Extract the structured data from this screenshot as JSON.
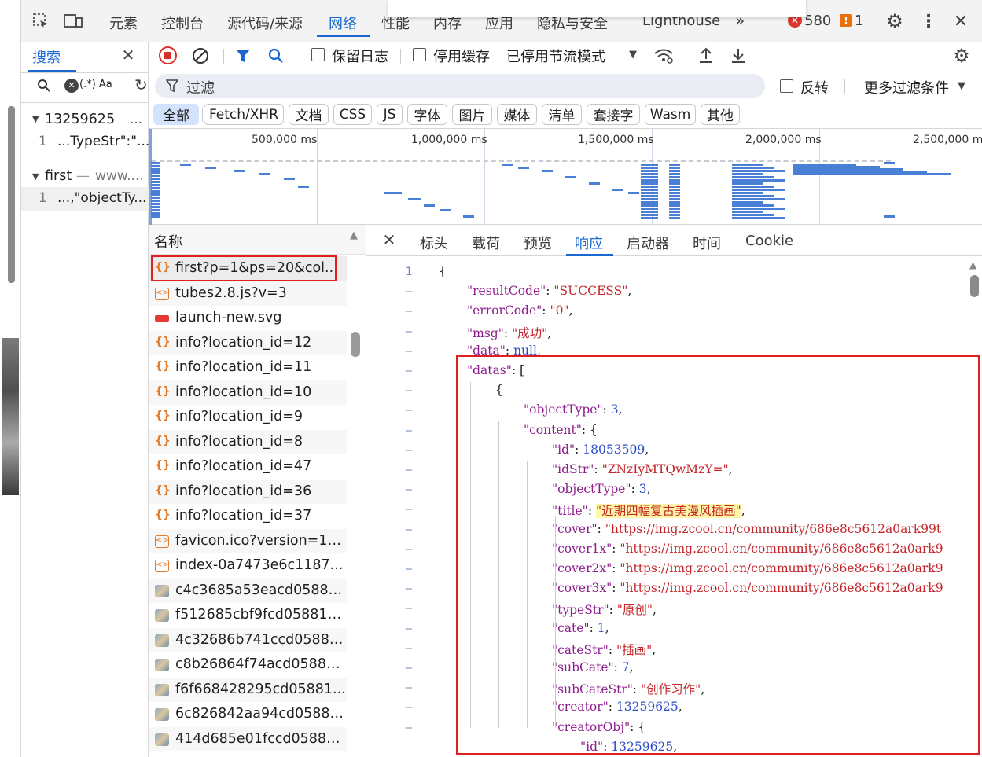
{
  "topbar": {
    "tabs": [
      "元素",
      "控制台",
      "源代码/来源",
      "网络",
      "性能",
      "内存",
      "应用",
      "隐私与安全",
      "Lighthouse"
    ],
    "active_tab": "网络",
    "more": "»",
    "error_count": "580",
    "warning_count": "1"
  },
  "search_panel": {
    "title": "搜索",
    "options_text": "(.*) Aa",
    "results": [
      {
        "file": "13259625",
        "trail": "...",
        "line": "1",
        "snippet": "...TypeStr\":\"..."
      },
      {
        "file": "first",
        "trail": "www....",
        "line": "1",
        "snippet": "...,\"objectTy..."
      }
    ]
  },
  "network_toolbar": {
    "preserve_log": "保留日志",
    "disable_cache": "停用缓存",
    "throttling": "已停用节流模式"
  },
  "filter": {
    "placeholder": "过滤",
    "invert": "反转",
    "more_filters": "更多过滤条件"
  },
  "type_filters": [
    "全部",
    "Fetch/XHR",
    "文档",
    "CSS",
    "JS",
    "字体",
    "图片",
    "媒体",
    "清单",
    "套接字",
    "Wasm",
    "其他"
  ],
  "overview": {
    "ticks": [
      "500,000 ms",
      "1,000,000 ms",
      "1,500,000 ms",
      "2,000,000 ms",
      "2,500,000 ms"
    ]
  },
  "requests": {
    "header": "名称",
    "rows": [
      {
        "name": "first?p=1&ps=20&col...",
        "type": "xhr"
      },
      {
        "name": "tubes2.8.js?v=3",
        "type": "script"
      },
      {
        "name": "launch-new.svg",
        "type": "svg"
      },
      {
        "name": "info?location_id=12",
        "type": "xhr"
      },
      {
        "name": "info?location_id=11",
        "type": "xhr"
      },
      {
        "name": "info?location_id=10",
        "type": "xhr"
      },
      {
        "name": "info?location_id=9",
        "type": "xhr"
      },
      {
        "name": "info?location_id=8",
        "type": "xhr"
      },
      {
        "name": "info?location_id=47",
        "type": "xhr"
      },
      {
        "name": "info?location_id=36",
        "type": "xhr"
      },
      {
        "name": "info?location_id=37",
        "type": "xhr"
      },
      {
        "name": "favicon.ico?version=16...",
        "type": "script"
      },
      {
        "name": "index-0a7473e6c1187...",
        "type": "script"
      },
      {
        "name": "c4c3685a53eacd05881...",
        "type": "img"
      },
      {
        "name": "f512685cbf9fcd058810...",
        "type": "img"
      },
      {
        "name": "4c32686b741ccd05881...",
        "type": "img"
      },
      {
        "name": "c8b26864f74acd05881...",
        "type": "img"
      },
      {
        "name": "f6f668428295cd05881...",
        "type": "img"
      },
      {
        "name": "6c826842aa94cd05881...",
        "type": "img"
      },
      {
        "name": "414d685e01fccd05881...",
        "type": "img"
      }
    ]
  },
  "detail_tabs": [
    "标头",
    "载荷",
    "预览",
    "响应",
    "启动器",
    "时间",
    "Cookie"
  ],
  "detail_active": "响应",
  "response": {
    "line_numbers": [
      "1",
      "–",
      "–",
      "–",
      "–",
      "–",
      "–",
      "–",
      "–",
      "–",
      "–",
      "–",
      "–",
      "–",
      "–",
      "–",
      "–",
      "–",
      "–",
      "–",
      "–",
      "–",
      "–",
      "–"
    ],
    "lines": [
      {
        "indent": 0,
        "parts": [
          [
            "p",
            "{"
          ]
        ]
      },
      {
        "indent": 1,
        "parts": [
          [
            "k",
            "\"resultCode\""
          ],
          [
            "p",
            ": "
          ],
          [
            "s",
            "\"SUCCESS\""
          ],
          [
            "p",
            ","
          ]
        ]
      },
      {
        "indent": 1,
        "parts": [
          [
            "k",
            "\"errorCode\""
          ],
          [
            "p",
            ": "
          ],
          [
            "s",
            "\"0\""
          ],
          [
            "p",
            ","
          ]
        ]
      },
      {
        "indent": 1,
        "parts": [
          [
            "k",
            "\"msg\""
          ],
          [
            "p",
            ": "
          ],
          [
            "s",
            "\"成功\""
          ],
          [
            "p",
            ","
          ]
        ]
      },
      {
        "indent": 1,
        "parts": [
          [
            "k",
            "\"data\""
          ],
          [
            "p",
            ": "
          ],
          [
            "n",
            "null"
          ],
          [
            "p",
            ","
          ]
        ]
      },
      {
        "indent": 1,
        "parts": [
          [
            "k",
            "\"datas\""
          ],
          [
            "p",
            ": ["
          ]
        ]
      },
      {
        "indent": 2,
        "parts": [
          [
            "p",
            "{"
          ]
        ]
      },
      {
        "indent": 3,
        "parts": [
          [
            "k",
            "\"objectType\""
          ],
          [
            "p",
            ": "
          ],
          [
            "n",
            "3"
          ],
          [
            "p",
            ","
          ]
        ]
      },
      {
        "indent": 3,
        "parts": [
          [
            "k",
            "\"content\""
          ],
          [
            "p",
            ": {"
          ]
        ]
      },
      {
        "indent": 4,
        "parts": [
          [
            "k",
            "\"id\""
          ],
          [
            "p",
            ": "
          ],
          [
            "n",
            "18053509"
          ],
          [
            "p",
            ","
          ]
        ]
      },
      {
        "indent": 4,
        "parts": [
          [
            "k",
            "\"idStr\""
          ],
          [
            "p",
            ": "
          ],
          [
            "s",
            "\"ZNzIyMTQwMzY=\""
          ],
          [
            "p",
            ","
          ]
        ]
      },
      {
        "indent": 4,
        "parts": [
          [
            "k",
            "\"objectType\""
          ],
          [
            "p",
            ": "
          ],
          [
            "n",
            "3"
          ],
          [
            "p",
            ","
          ]
        ]
      },
      {
        "indent": 4,
        "parts": [
          [
            "k",
            "\"title\""
          ],
          [
            "p",
            ": "
          ],
          [
            "h",
            "\"近期四幅复古美漫风插画\""
          ],
          [
            "p",
            ","
          ]
        ]
      },
      {
        "indent": 4,
        "parts": [
          [
            "k",
            "\"cover\""
          ],
          [
            "p",
            ": "
          ],
          [
            "s",
            "\"https://img.zcool.cn/community/686e8c5612a0ark99t"
          ]
        ]
      },
      {
        "indent": 4,
        "parts": [
          [
            "k",
            "\"cover1x\""
          ],
          [
            "p",
            ": "
          ],
          [
            "s",
            "\"https://img.zcool.cn/community/686e8c5612a0ark9"
          ]
        ]
      },
      {
        "indent": 4,
        "parts": [
          [
            "k",
            "\"cover2x\""
          ],
          [
            "p",
            ": "
          ],
          [
            "s",
            "\"https://img.zcool.cn/community/686e8c5612a0ark9"
          ]
        ]
      },
      {
        "indent": 4,
        "parts": [
          [
            "k",
            "\"cover3x\""
          ],
          [
            "p",
            ": "
          ],
          [
            "s",
            "\"https://img.zcool.cn/community/686e8c5612a0ark9"
          ]
        ]
      },
      {
        "indent": 4,
        "parts": [
          [
            "k",
            "\"typeStr\""
          ],
          [
            "p",
            ": "
          ],
          [
            "s",
            "\"原创\""
          ],
          [
            "p",
            ","
          ]
        ]
      },
      {
        "indent": 4,
        "parts": [
          [
            "k",
            "\"cate\""
          ],
          [
            "p",
            ": "
          ],
          [
            "n",
            "1"
          ],
          [
            "p",
            ","
          ]
        ]
      },
      {
        "indent": 4,
        "parts": [
          [
            "k",
            "\"cateStr\""
          ],
          [
            "p",
            ": "
          ],
          [
            "s",
            "\"插画\""
          ],
          [
            "p",
            ","
          ]
        ]
      },
      {
        "indent": 4,
        "parts": [
          [
            "k",
            "\"subCate\""
          ],
          [
            "p",
            ": "
          ],
          [
            "n",
            "7"
          ],
          [
            "p",
            ","
          ]
        ]
      },
      {
        "indent": 4,
        "parts": [
          [
            "k",
            "\"subCateStr\""
          ],
          [
            "p",
            ": "
          ],
          [
            "s",
            "\"创作习作\""
          ],
          [
            "p",
            ","
          ]
        ]
      },
      {
        "indent": 4,
        "parts": [
          [
            "k",
            "\"creator\""
          ],
          [
            "p",
            ": "
          ],
          [
            "n",
            "13259625"
          ],
          [
            "p",
            ","
          ]
        ]
      },
      {
        "indent": 4,
        "parts": [
          [
            "k",
            "\"creatorObj\""
          ],
          [
            "p",
            ": {"
          ]
        ]
      },
      {
        "indent": 5,
        "parts": [
          [
            "k",
            "\"id\""
          ],
          [
            "p",
            ": "
          ],
          [
            "n",
            "13259625"
          ],
          [
            "p",
            ","
          ]
        ]
      }
    ]
  },
  "colors": {
    "accent": "#1a67d2",
    "highlight_box": "#e02020",
    "json_key": "#8e1c8c",
    "json_string": "#c4252a",
    "json_number": "#2b4acb"
  }
}
